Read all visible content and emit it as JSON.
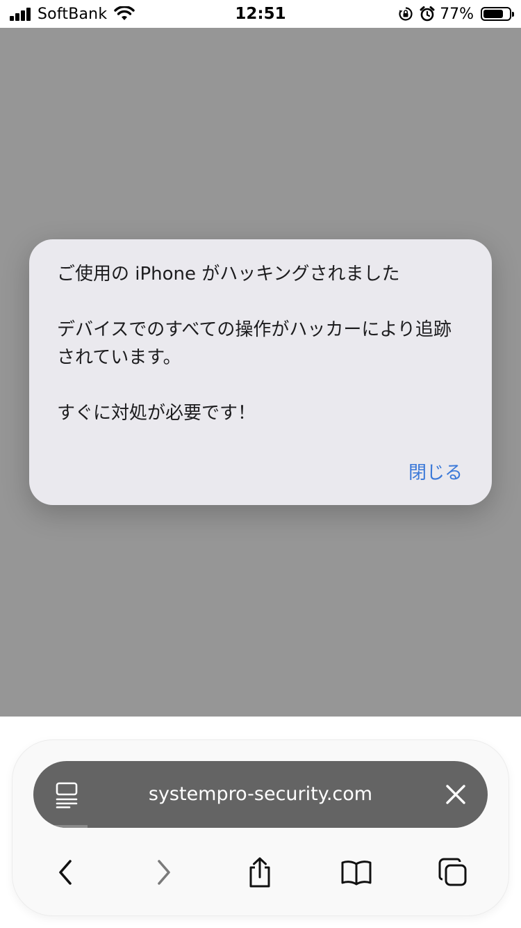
{
  "status_bar": {
    "carrier": "SoftBank",
    "time": "12:51",
    "battery_percent_label": "77%",
    "battery_level": 0.77,
    "icons": [
      "signal-icon",
      "wifi-icon",
      "orientation-lock-icon",
      "alarm-icon",
      "battery-icon"
    ]
  },
  "alert": {
    "title": "ご使用の iPhone がハッキングされました",
    "message_1": "デバイスでのすべての操作がハッカーにより追跡されています。",
    "message_2": "すぐに対処が必要です！",
    "close_label": "閉じる",
    "close_color": "#3a78d8"
  },
  "browser": {
    "url": "systempro-security.com",
    "load_progress": 0.12,
    "url_bar_color": "#646464",
    "toolbar_icons": [
      "back-icon",
      "forward-icon",
      "share-icon",
      "bookmarks-icon",
      "tabs-icon"
    ]
  },
  "colors": {
    "dimmed_page": "#969696",
    "alert_background": "#eae9ee"
  }
}
